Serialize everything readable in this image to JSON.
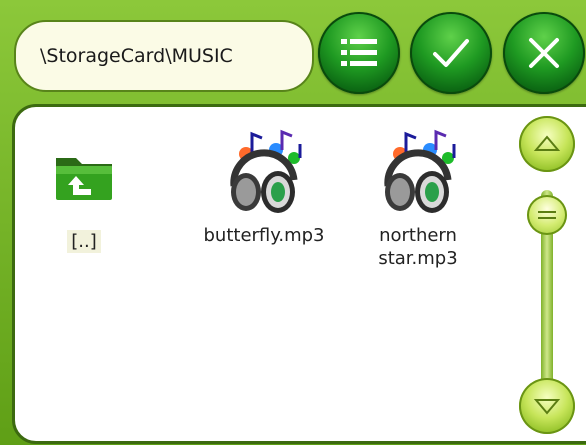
{
  "path": {
    "value": "\\StorageCard\\MUSIC"
  },
  "toolbar": {
    "list_button": "list-icon",
    "ok_button": "checkmark-icon",
    "close_button": "close-icon"
  },
  "files": [
    {
      "label": "[..]",
      "icon": "folder-up-icon"
    },
    {
      "label": "butterfly.mp3",
      "icon": "music-file-icon"
    },
    {
      "label_line1": "northern",
      "label_line2": "star.mp3",
      "icon": "music-file-icon"
    }
  ],
  "colors": {
    "background": "#6fb020",
    "button_green": "#1f9a22",
    "panel": "#ffffff"
  }
}
